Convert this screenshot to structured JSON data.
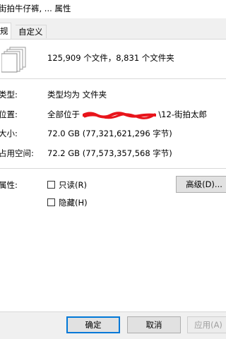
{
  "window": {
    "title": "街拍牛仔裤, ... 属性"
  },
  "tabs": [
    {
      "label": "规"
    },
    {
      "label": "自定义"
    }
  ],
  "summary": {
    "text": "125,909 个文件，8,831 个文件夹"
  },
  "fields": [
    {
      "label": "类型:",
      "value": "类型均为 文件夹"
    },
    {
      "label": "位置:",
      "value_prefix": "全部位于 ",
      "value_suffix": "\\12-街拍太郎"
    },
    {
      "label": "大小:",
      "value": "72.0 GB (77,321,621,296 字节)"
    },
    {
      "label": "占用空间:",
      "value": "72.2 GB (77,573,357,568 字节)"
    }
  ],
  "attributes": {
    "label": "属性:",
    "readonly": {
      "label": "只读(R)",
      "checked": false
    },
    "hidden": {
      "label": "隐藏(H)",
      "checked": false
    },
    "advanced_button": "高级(D)..."
  },
  "buttons": {
    "ok": "确定",
    "cancel": "取消",
    "apply": "应用(A)"
  },
  "colors": {
    "dialog_bg": "#f0f0f0",
    "panel_bg": "#ffffff",
    "default_border": "#0078d7",
    "redaction": "#e8141b"
  }
}
